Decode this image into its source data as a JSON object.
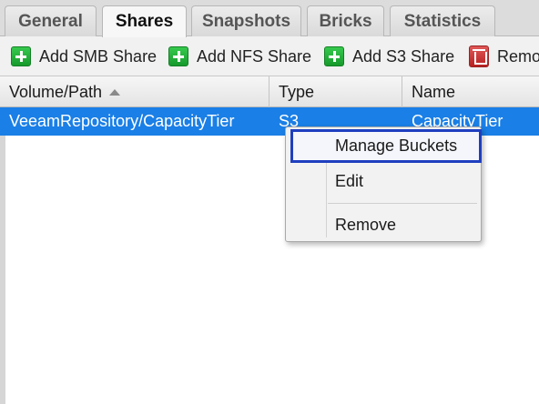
{
  "tabs": [
    {
      "label": "General"
    },
    {
      "label": "Shares",
      "active": true
    },
    {
      "label": "Snapshots"
    },
    {
      "label": "Bricks"
    },
    {
      "label": "Statistics"
    }
  ],
  "toolbar": {
    "add_smb_label": "Add SMB Share",
    "add_nfs_label": "Add NFS Share",
    "add_s3_label": "Add S3 Share",
    "remove_label": "Remo"
  },
  "grid": {
    "columns": [
      {
        "label": "Volume/Path",
        "sort": "ascending"
      },
      {
        "label": "Type"
      },
      {
        "label": "Name"
      }
    ],
    "rows": [
      {
        "path": "VeeamRepository/CapacityTier",
        "type": "S3",
        "name": "CapacityTier",
        "selected": true
      }
    ]
  },
  "context_menu": {
    "items": [
      {
        "label": "Manage Buckets",
        "highlighted": true
      },
      {
        "label": "Edit"
      },
      {
        "label": "Remove"
      }
    ]
  },
  "colors": {
    "selection": "#1a7fe6",
    "highlight_border": "#1f3fbf",
    "add_icon": "#22b33a",
    "remove_icon": "#c93333"
  }
}
